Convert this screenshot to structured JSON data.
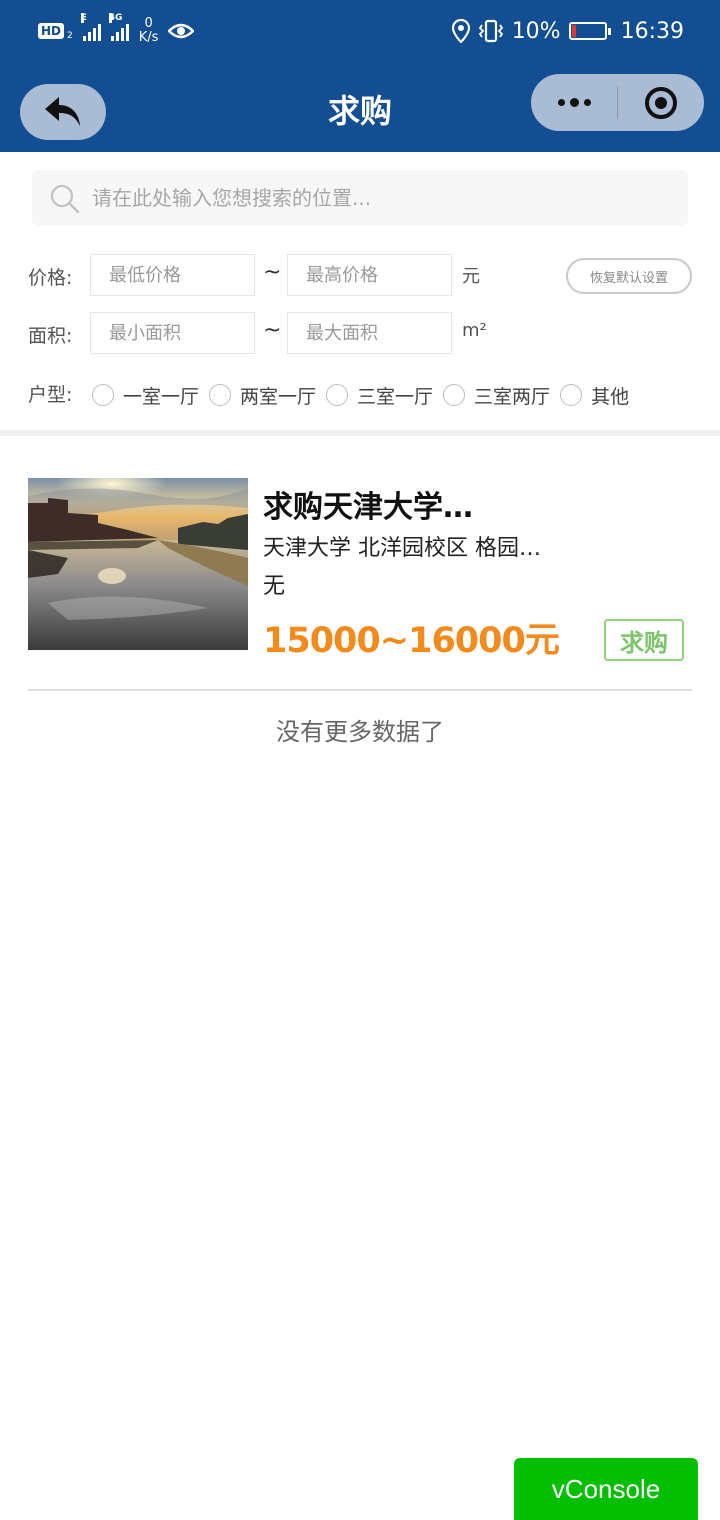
{
  "status_bar": {
    "hd_label": "HD",
    "hd_sub": "2",
    "net1_label": "E",
    "net2_label": "4G",
    "speed_value": "0",
    "speed_unit": "K/s",
    "battery_percent": "10%",
    "time": "16:39",
    "icons": [
      "eye-icon",
      "location-icon",
      "vibrate-icon",
      "battery-icon"
    ],
    "battery_level": 0.1
  },
  "nav": {
    "title": "求购",
    "icons": [
      "back-arrow-icon",
      "more-dots-icon",
      "target-close-icon"
    ],
    "color": "#134d92"
  },
  "search": {
    "placeholder": "请在此处输入您想搜索的位置...",
    "icon": "search-icon"
  },
  "filters": {
    "price_label": "价格:",
    "price_min_placeholder": "最低价格",
    "price_max_placeholder": "最高价格",
    "price_unit": "元",
    "area_label": "面积:",
    "area_min_placeholder": "最小面积",
    "area_max_placeholder": "最大面积",
    "area_unit": "m²",
    "range_separator": "~",
    "layout_label": "户型:",
    "layout_options": [
      "一室一厅",
      "两室一厅",
      "三室一厅",
      "三室两厅",
      "其他"
    ],
    "reset_label": "恢复默认设置"
  },
  "listing": {
    "title": "求购天津大学…",
    "location": "天津大学 北洋园校区 格园…",
    "extra": "无",
    "price": "15000~16000元",
    "badge": "求购",
    "price_color": "#f28b1c",
    "badge_color": "#7cc56a"
  },
  "end_text": "没有更多数据了",
  "vconsole_label": "vConsole"
}
